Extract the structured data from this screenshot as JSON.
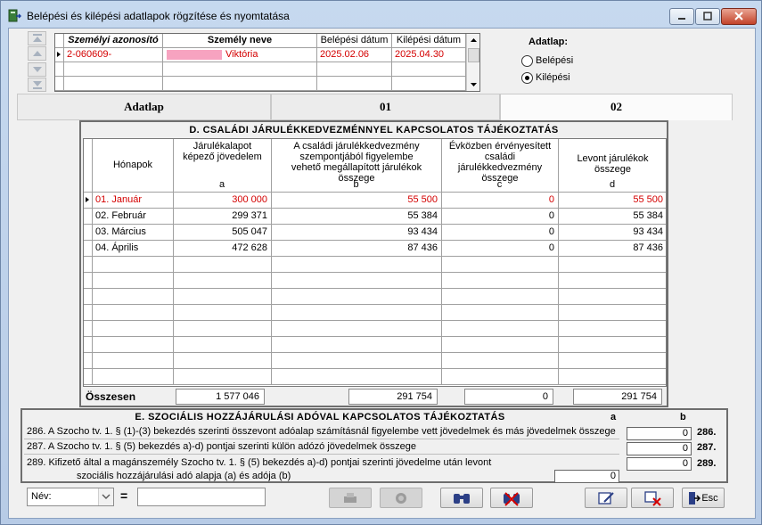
{
  "window": {
    "title": "Belépési és kilépési adatlapok rögzítése és nyomtatása"
  },
  "person_grid": {
    "headers": [
      "Személyi azonosító",
      "Személy neve",
      "Belépési dátum",
      "Kilépési dátum"
    ],
    "rows": [
      {
        "id": "2-060609-",
        "name": "Viktória",
        "entry": "2025.02.06",
        "exit": "2025.04.30"
      }
    ]
  },
  "adatlap": {
    "label": "Adatlap:",
    "options": [
      "Belépési",
      "Kilépési"
    ],
    "selected": "Kilépési"
  },
  "tabs": [
    "Adatlap",
    "01",
    "02"
  ],
  "selected_tab": "02",
  "section_d": {
    "title": "D. CSALÁDI JÁRULÉKKEDVEZMÉNNYEL KAPCSOLATOS TÁJÉKOZTATÁS",
    "headers": {
      "month": "Hónapok",
      "a": "Járulékalapot képező jövedelem",
      "a_letter": "a",
      "b": "A családi járulékkedvezmény szempontjából figyelembe vehető megállapított járulékok összege",
      "b_letter": "b",
      "c": "Évközben érvényesített családi járulékkedvezmény összege",
      "c_letter": "c",
      "d": "Levont járulékok összege",
      "d_letter": "d"
    },
    "rows": [
      {
        "month": "01. Január",
        "a": "300 000",
        "b": "55 500",
        "c": "0",
        "d": "55 500"
      },
      {
        "month": "02. Február",
        "a": "299 371",
        "b": "55 384",
        "c": "0",
        "d": "55 384"
      },
      {
        "month": "03. Március",
        "a": "505 047",
        "b": "93 434",
        "c": "0",
        "d": "93 434"
      },
      {
        "month": "04. Április",
        "a": "472 628",
        "b": "87 436",
        "c": "0",
        "d": "87 436"
      }
    ],
    "totals": {
      "label": "Összesen",
      "a": "1 577 046",
      "b": "291 754",
      "c": "0",
      "d": "291 754"
    }
  },
  "section_e": {
    "title": "E. SZOCIÁLIS HOZZÁJÁRULÁSI ADÓVAL KAPCSOLATOS TÁJÉKOZTATÁS",
    "col_a": "a",
    "col_b": "b",
    "rows": [
      {
        "text": "286. A Szocho tv. 1. § (1)-(3) bekezdés szerinti összevont adóalap számításnál figyelembe vett jövedelmek és más jövedelmek összege",
        "b": "0",
        "num": "286."
      },
      {
        "text": "287. A Szocho tv. 1. § (5) bekezdés a)-d) pontjai szerinti külön adózó jövedelmek összege",
        "b": "0",
        "num": "287."
      },
      {
        "text": "289. Kifizető által a magánszemély Szocho tv. 1. § (5) bekezdés a)-d) pontjai szerinti jövedelme után levont",
        "text2": "szociális hozzájárulási adó alapja (a) és adója (b)",
        "a": "0",
        "b": "0",
        "num": "289."
      }
    ]
  },
  "bottom": {
    "filter_select": "Név:",
    "equals": "=",
    "filter_value": "",
    "esc_label": "Esc"
  },
  "colors": {
    "accent_red": "#d40000",
    "highlight_pink": "#f7a3c0"
  }
}
